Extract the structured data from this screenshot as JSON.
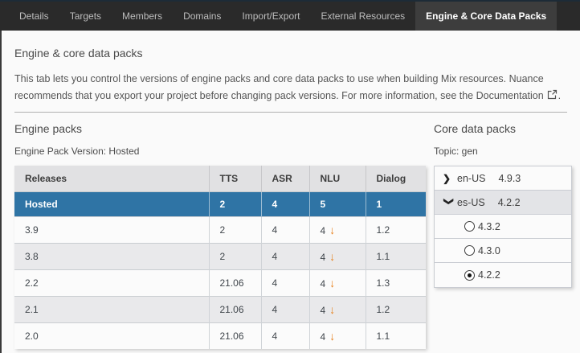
{
  "tabs": {
    "items": [
      {
        "label": "Details",
        "active": false
      },
      {
        "label": "Targets",
        "active": false
      },
      {
        "label": "Members",
        "active": false
      },
      {
        "label": "Domains",
        "active": false
      },
      {
        "label": "Import/Export",
        "active": false
      },
      {
        "label": "External Resources",
        "active": false
      },
      {
        "label": "Engine & Core Data Packs",
        "active": true
      }
    ]
  },
  "page": {
    "title": "Engine & core data packs",
    "description": "This tab lets you control the versions of engine packs and core data packs to use when building Mix resources. Nuance recommends that you export your project before changing pack versions. For more information, see the ",
    "documentation_label": "Documentation",
    "description_suffix": "."
  },
  "engine_packs": {
    "title": "Engine packs",
    "version_label": "Engine Pack Version: Hosted",
    "table": {
      "columns": [
        "Releases",
        "TTS",
        "ASR",
        "NLU",
        "Dialog"
      ],
      "rows": [
        {
          "release": "Hosted",
          "tts": "2",
          "asr": "4",
          "nlu": "5",
          "dialog": "1",
          "selected": true,
          "nlu_downgrade": false
        },
        {
          "release": "3.9",
          "tts": "2",
          "asr": "4",
          "nlu": "4",
          "dialog": "1.2",
          "selected": false,
          "nlu_downgrade": true
        },
        {
          "release": "3.8",
          "tts": "2",
          "asr": "4",
          "nlu": "4",
          "dialog": "1.1",
          "selected": false,
          "nlu_downgrade": true
        },
        {
          "release": "2.2",
          "tts": "21.06",
          "asr": "4",
          "nlu": "4",
          "dialog": "1.3",
          "selected": false,
          "nlu_downgrade": true
        },
        {
          "release": "2.1",
          "tts": "21.06",
          "asr": "4",
          "nlu": "4",
          "dialog": "1.2",
          "selected": false,
          "nlu_downgrade": true
        },
        {
          "release": "2.0",
          "tts": "21.06",
          "asr": "4",
          "nlu": "4",
          "dialog": "1.1",
          "selected": false,
          "nlu_downgrade": true
        }
      ]
    }
  },
  "core_data_packs": {
    "title": "Core data packs",
    "topic_label": "Topic: gen",
    "locales": [
      {
        "locale": "en-US",
        "version": "4.9.3",
        "expanded": false,
        "options": []
      },
      {
        "locale": "es-US",
        "version": "4.2.2",
        "expanded": true,
        "options": [
          {
            "version": "4.3.2",
            "selected": false
          },
          {
            "version": "4.3.0",
            "selected": false
          },
          {
            "version": "4.2.2",
            "selected": true
          }
        ]
      }
    ]
  },
  "icons": {
    "chevron": "❯",
    "down_arrow": "↓"
  },
  "colors": {
    "accent_blue": "#2F74A5",
    "downgrade_orange": "#E8821E",
    "tabbar_bg": "#2A2A2A",
    "active_tab_bg": "#3D3D3D"
  }
}
